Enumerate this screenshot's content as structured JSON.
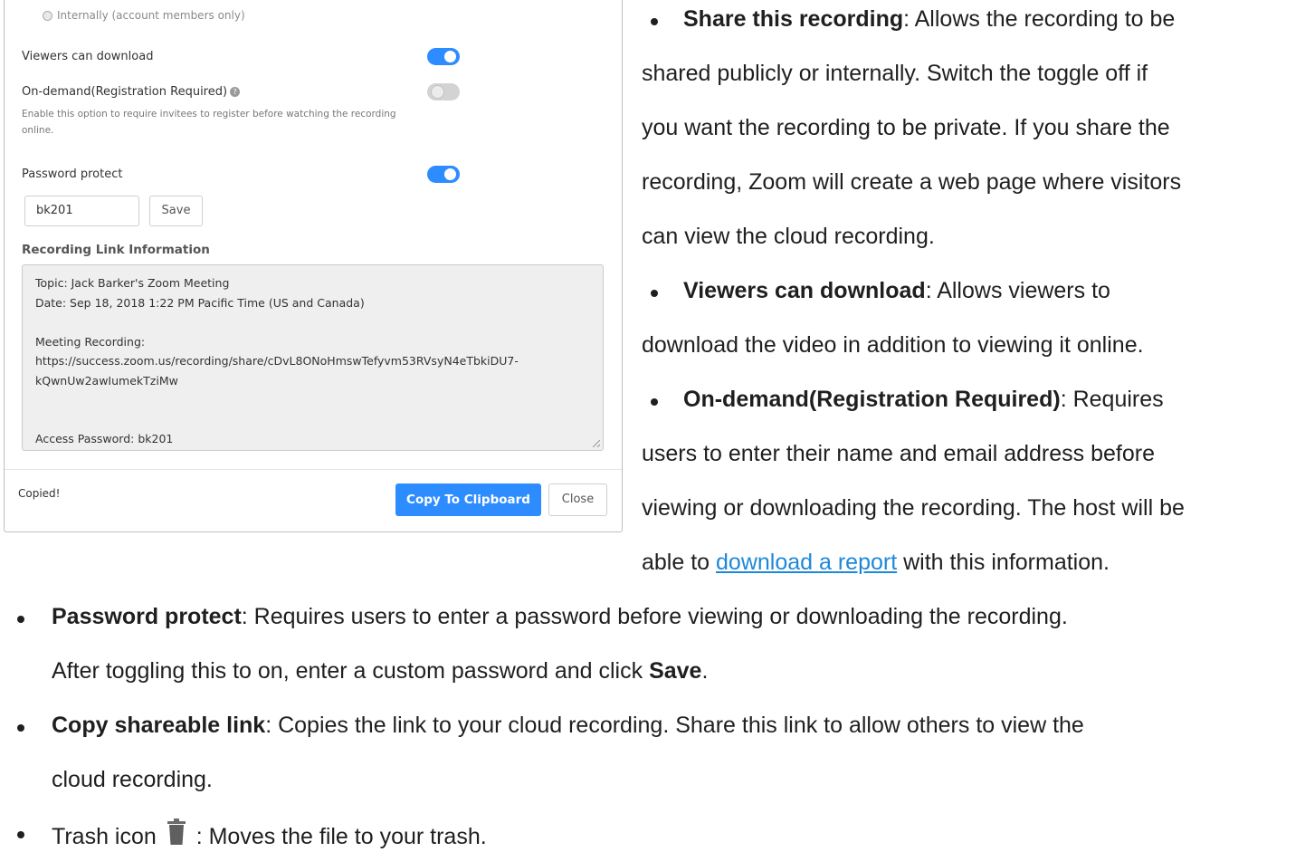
{
  "dialog": {
    "radio_label": "Internally (account members only)",
    "viewers_download_label": "Viewers can download",
    "on_demand_label": "On-demand(Registration Required)",
    "on_demand_help": "Enable this option to require invitees to register before watching the recording online.",
    "password_protect_label": "Password protect",
    "password_value": "bk201",
    "save_label": "Save",
    "recording_link_title": "Recording Link Information",
    "info_lines": [
      "Topic: Jack Barker's Zoom Meeting",
      "Date: Sep 18, 2018 1:22 PM Pacific Time (US and Canada)",
      "",
      "Meeting Recording:",
      "https://success.zoom.us/recording/share/cDvL8ONoHmswTefyvm53RVsyN4eTbkiDU7-",
      "kQwnUw2awIumekTziMw",
      "",
      "",
      "Access Password: bk201"
    ],
    "copied_text": "Copied!",
    "copy_button": "Copy To Clipboard",
    "close_button": "Close",
    "toggles": {
      "viewers_can_download": true,
      "on_demand": false,
      "password_protect": true
    },
    "colors": {
      "accent": "#2d8cff",
      "toggle_off": "#d3d3d3"
    }
  },
  "doc": {
    "share_title": "Share this recording",
    "share_l1": ": Allows the recording to be",
    "share_l2": "shared publicly or internally. Switch the toggle off if",
    "share_l3": "you want the recording to be private. If you share the",
    "share_l4": "recording, Zoom will create a web page where visitors",
    "share_l5": "can view the cloud recording.",
    "viewers_title": "Viewers can download",
    "viewers_l1": ": Allows viewers to",
    "viewers_l2": "download the video in addition to viewing it online.",
    "ondemand_title": "On-demand(Registration Required)",
    "ondemand_l1": ": Requires",
    "ondemand_l2": "users to enter their name and email address before",
    "ondemand_l3": "viewing or downloading the recording. The host will be",
    "ondemand_l4_pre": "able to ",
    "ondemand_link": "download a report",
    "ondemand_l4_post": " with this information.",
    "password_title": "Password protect",
    "password_l1": ": Requires users to enter a password before viewing or downloading the recording.",
    "password_l2_pre": "After toggling this to on, enter a custom password and click ",
    "password_l2_bold": "Save",
    "password_l2_post": ".",
    "copy_title": "Copy shareable link",
    "copy_l1": ": Copies the link to your cloud recording. Share this link to allow others to view the",
    "copy_l2": "cloud recording.",
    "trash_pre": "Trash icon",
    "trash_post": ": Moves the file to your trash.",
    "link_color": "#1e88d8",
    "trash_icon": "trash-icon"
  }
}
